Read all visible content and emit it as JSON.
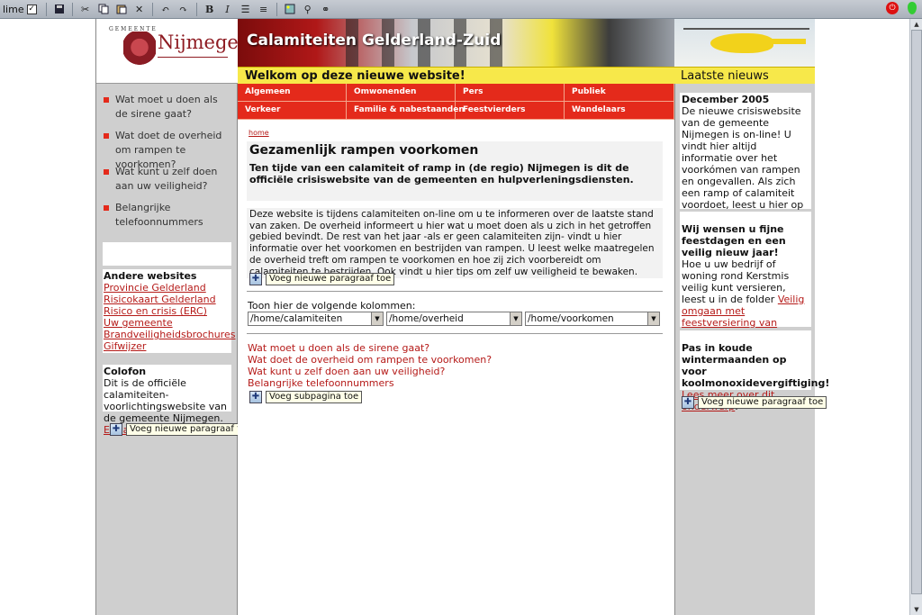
{
  "toolbar": {
    "mode_label": "lime",
    "mode_checked": "✓",
    "icons": [
      "save-icon",
      "cut-icon",
      "copy-icon",
      "paste-icon",
      "delete-icon",
      "undo-icon",
      "redo-icon",
      "bold-icon",
      "italic-icon",
      "ordered-list-icon",
      "unordered-list-icon",
      "image-icon",
      "attach-icon",
      "link-icon"
    ],
    "bold_glyph": "B",
    "italic_glyph": "I"
  },
  "header": {
    "logo_small": "GEMEENTE",
    "logo_name": "Nijmegen",
    "banner_title": "Calamiteiten Gelderland-Zuid",
    "welcome": "Welkom op deze nieuwe website!",
    "latest_news": "Laatste nieuws"
  },
  "nav": {
    "row1": [
      "Algemeen",
      "Omwonenden",
      "Pers",
      "Publiek"
    ],
    "row2": [
      "Verkeer",
      "Familie & nabestaanden",
      "Feestvierders",
      "Wandelaars"
    ]
  },
  "left": {
    "menu": [
      "Wat moet u doen als de sirene gaat?",
      "Wat doet de overheid om rampen te voorkomen?",
      "Wat kunt u zelf doen aan uw veiligheid?",
      "Belangrijke telefoonnummers"
    ],
    "other_sites_title": "Andere websites",
    "other_sites": [
      "Provincie Gelderland",
      "Risicokaart Gelderland",
      "Risico en crisis (ERC)",
      "Uw gemeente",
      "Brandveiligheidsbrochures",
      "Gifwijzer"
    ],
    "colofon_title": "Colofon",
    "colofon_text": "Dit is de officiële calamiteiten-voorlichtingswebsite van de gemeente Nijmegen.",
    "colofon_link": "E-mail",
    "add_paragraph": "Voeg nieuwe paragraaf toe"
  },
  "center": {
    "breadcrumb": "home",
    "title": "Gezamenlijk rampen voorkomen",
    "lead": "Ten tijde van een calamiteit of ramp in (de regio) Nijmegen is dit de officiële crisiswebsite van de gemeenten en hulpverleningsdiensten.",
    "body": "Deze website is tijdens calamiteiten on-line om u te informeren over de laatste stand van zaken. De overheid informeert u hier wat u moet doen als u zich in het getroffen gebied bevindt. De rest van het jaar -als er geen calamiteiten zijn- vindt u hier informatie over het voorkomen en bestrijden van rampen. U leest welke maatregelen de overheid treft om rampen te voorkomen en hoe zij zich voorbereidt om calamiteiten te bestrijden. Ook vindt u hier tips om zelf uw veiligheid te bewaken.",
    "add_paragraph": "Voeg nieuwe paragraaf toe",
    "columns_label": "Toon hier de volgende kolommen:",
    "selects": [
      "/home/calamiteiten",
      "/home/overheid",
      "/home/voorkomen"
    ],
    "links": [
      "Wat moet u doen als de sirene gaat?",
      "Wat doet de overheid om rampen te voorkomen?",
      "Wat kunt u zelf doen aan uw veiligheid?",
      "Belangrijke telefoonnummers"
    ],
    "add_subpage": "Voeg subpagina toe"
  },
  "right": {
    "news1_title": "December 2005",
    "news1_text": "De nieuwe crisiswebsite van de gemeente Nijmegen is on-line! U vindt hier altijd informatie over het voorkómen van rampen en ongevallen. Als zich een ramp of calamiteit voordoet, leest u hier op elk moment van de dag de actuele stand van zaken.",
    "news2_title": "Wij wensen u fijne feestdagen en een veilig nieuw jaar!",
    "news2_text": "Hoe u uw bedrijf of woning rond Kerstmis veilig kunt versieren, leest u in de folder",
    "news2_link": "Veilig omgaan met feestversiering van Brandweer Nijmegen",
    "news2_after": ".",
    "news3_title": "Pas in koude wintermaanden op voor koolmonoxidevergiftiging!",
    "news3_link": "Lees meer over dit onderwerp",
    "news3_after": ".",
    "add_paragraph": "Voeg nieuwe paragraaf toe"
  },
  "colors": {
    "accent_red": "#e42a1b",
    "link_red": "#b51a18",
    "welcome_yellow": "#f7e84a",
    "side_gray": "#cfcfcf"
  }
}
